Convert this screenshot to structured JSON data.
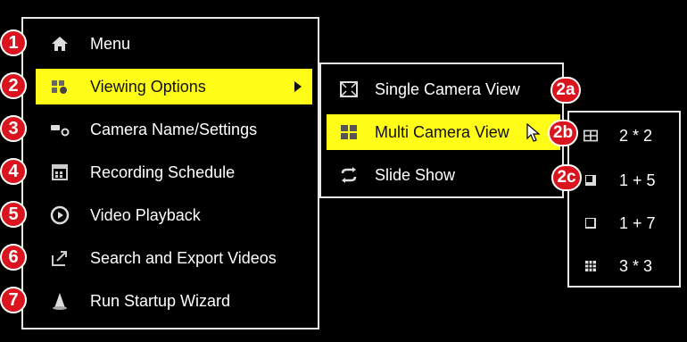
{
  "main_menu": {
    "items": [
      {
        "label": "Menu",
        "icon": "home-icon",
        "badge": "1"
      },
      {
        "label": "Viewing Options",
        "icon": "viewing-options-icon",
        "badge": "2",
        "selected": true
      },
      {
        "label": "Camera Name/Settings",
        "icon": "camera-icon",
        "badge": "3"
      },
      {
        "label": "Recording Schedule",
        "icon": "calendar-icon",
        "badge": "4"
      },
      {
        "label": "Video Playback",
        "icon": "playback-icon",
        "badge": "5"
      },
      {
        "label": "Search and Export Videos",
        "icon": "export-icon",
        "badge": "6"
      },
      {
        "label": "Run Startup Wizard",
        "icon": "wizard-icon",
        "badge": "7"
      }
    ]
  },
  "sub_menu": {
    "items": [
      {
        "label": "Single Camera View",
        "icon": "single-view-icon",
        "badge": "2a"
      },
      {
        "label": "Multi Camera View",
        "icon": "multi-view-icon",
        "badge": "2b",
        "selected": true
      },
      {
        "label": "Slide Show",
        "icon": "slideshow-icon"
      }
    ]
  },
  "layout_menu": {
    "badge": "2c",
    "items": [
      {
        "label": "2 * 2",
        "icon": "grid-2x2-icon"
      },
      {
        "label": "1 + 5",
        "icon": "grid-1plus5-icon"
      },
      {
        "label": "1 + 7",
        "icon": "grid-1plus7-icon"
      },
      {
        "label": "3 * 3",
        "icon": "grid-3x3-icon"
      }
    ]
  },
  "colors": {
    "highlight": "#fffc17",
    "badge": "#d9141e",
    "border": "#e8e8e8",
    "background": "#000000"
  }
}
